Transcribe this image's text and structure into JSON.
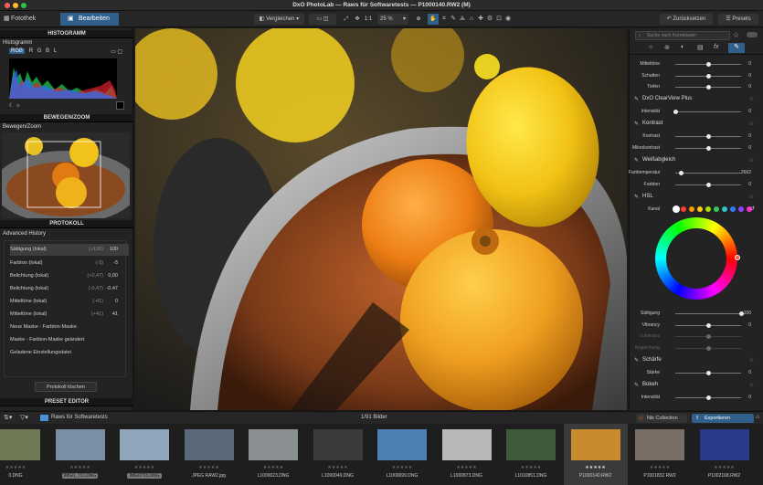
{
  "window": {
    "title": "DxO PhotoLab — Raws für Softwaretests — P1000140.RW2 (M)"
  },
  "tabs": [
    {
      "label": "Fotothek"
    },
    {
      "label": "Bearbeiten"
    }
  ],
  "toolbar": {
    "compare_label": "Vergleichen",
    "ratio_label": "1:1",
    "zoom_value": "25 %",
    "reset_label": "Zurücksetzen",
    "presets_label": "Presets"
  },
  "left": {
    "histogram_header": "HISTOGRAMM",
    "histogram_sub": "Histogramm",
    "channels": [
      "RGB",
      "R",
      "G",
      "B",
      "L"
    ],
    "move_header": "BEWEGEN/ZOOM",
    "move_sub": "Bewegen/Zoom",
    "history_header": "PROTOKOLL",
    "history_sub": "Advanced History",
    "history_items": [
      {
        "label": "Sättigung (lokal)",
        "delta": "(+100)",
        "value": "100"
      },
      {
        "label": "Farbton (lokal)",
        "delta": "(-5)",
        "value": "-5"
      },
      {
        "label": "Belichtung (lokal)",
        "delta": "(+0,47)",
        "value": "0,00"
      },
      {
        "label": "Belichtung (lokal)",
        "delta": "(-0,47)",
        "value": "-0,47"
      },
      {
        "label": "Mitteltöne (lokal)",
        "delta": "(-41)",
        "value": "0"
      },
      {
        "label": "Mitteltöne (lokal)",
        "delta": "(+41)",
        "value": "41"
      },
      {
        "label": "Neue Maske - Farbton-Maske",
        "delta": "",
        "value": ""
      },
      {
        "label": "Maske - Farbton-Maske geändert",
        "delta": "",
        "value": ""
      },
      {
        "label": "Geladene Einstellungsdatei",
        "delta": "",
        "value": ""
      }
    ],
    "clear_history_label": "Protokoll löschen",
    "preset_header": "PRESET EDITOR"
  },
  "right": {
    "search_placeholder": "Suche nach Korrekturen",
    "tone_rows": [
      {
        "label": "Mitteltöne",
        "value": "0",
        "pos": 0.5
      },
      {
        "label": "Schatten",
        "value": "0",
        "pos": 0.5
      },
      {
        "label": "Tiefen",
        "value": "0",
        "pos": 0.5
      }
    ],
    "clearview": {
      "title": "DxO ClearView Plus",
      "label": "Intensität",
      "value": "0",
      "pos": 0.0
    },
    "contrast": {
      "title": "Kontrast",
      "rows": [
        {
          "label": "Kontrast",
          "value": "0",
          "pos": 0.5
        },
        {
          "label": "Mikrokontrast",
          "value": "0",
          "pos": 0.5
        }
      ]
    },
    "wb": {
      "title": "Weißabgleich",
      "rows": [
        {
          "label": "Farbtemperatur",
          "value": "2662",
          "pos": 0.08
        },
        {
          "label": "Farbton",
          "value": "0",
          "pos": 0.5
        }
      ]
    },
    "hsl": {
      "title": "HSL",
      "channel_label": "Kanal",
      "swatches": [
        "#ffffff",
        "#ff3b30",
        "#ff9500",
        "#ffcc00",
        "#a8e000",
        "#34c759",
        "#2ec4c4",
        "#2f7bff",
        "#8e44ff",
        "#ff2dd2"
      ],
      "rows": [
        {
          "label": "Sättigung",
          "value": "100",
          "pos": 1.0
        },
        {
          "label": "Vibrancy",
          "value": "0",
          "pos": 0.5
        },
        {
          "label": "Luminanz",
          "value": "",
          "pos": 0.5
        },
        {
          "label": "Angleichung",
          "value": "",
          "pos": 0.5
        }
      ]
    },
    "sharp": {
      "title": "Schärfe",
      "label": "Stärke",
      "value": "0",
      "pos": 0.5
    },
    "bokeh": {
      "title": "Bokeh",
      "label": "Intensität",
      "value": "0",
      "pos": 0.5
    }
  },
  "filmbar": {
    "folder": "Raws für Softwaretests",
    "count": "1/91 Bilder",
    "nik_label": "Nik Collection",
    "export_label": "Exportieren"
  },
  "filmstrip": [
    {
      "name": "0.DNG",
      "stars": "★★★★★",
      "highlight": false,
      "col": "#6f7b57"
    },
    {
      "name": "IMG0_TCI.DNG",
      "stars": "★★★★★",
      "highlight": true,
      "col": "#7a8fa6"
    },
    {
      "name": "IMG0703.DNG",
      "stars": "★★★★★",
      "highlight": true,
      "col": "#8fa6bb"
    },
    {
      "name": "JPEG RAW2.jpg",
      "stars": "★★★★★",
      "highlight": false,
      "col": "#5b6a7a"
    },
    {
      "name": "L1000023.DNG",
      "stars": "★★★★★",
      "highlight": false,
      "col": "#8a8f92"
    },
    {
      "name": "L1000049.DNG",
      "stars": "★★★★★",
      "highlight": false,
      "col": "#3a3a3a"
    },
    {
      "name": "L1000699.DNG",
      "stars": "★★★★★",
      "highlight": false,
      "col": "#4d7fb0"
    },
    {
      "name": "L1000873.DNG",
      "stars": "★★★★★",
      "highlight": false,
      "col": "#b8b8b8"
    },
    {
      "name": "L1010851.DNG",
      "stars": "★★★★★",
      "highlight": false,
      "col": "#3f5a3a"
    },
    {
      "name": "P1000140.RW2",
      "stars": "★★★★★",
      "highlight": false,
      "col": "#c98a2e"
    },
    {
      "name": "P1001832.RW2",
      "stars": "★★★★★",
      "highlight": false,
      "col": "#7a6f66"
    },
    {
      "name": "P1002168.RW2",
      "stars": "★★★★★",
      "highlight": false,
      "col": "#2a3a8a"
    }
  ]
}
